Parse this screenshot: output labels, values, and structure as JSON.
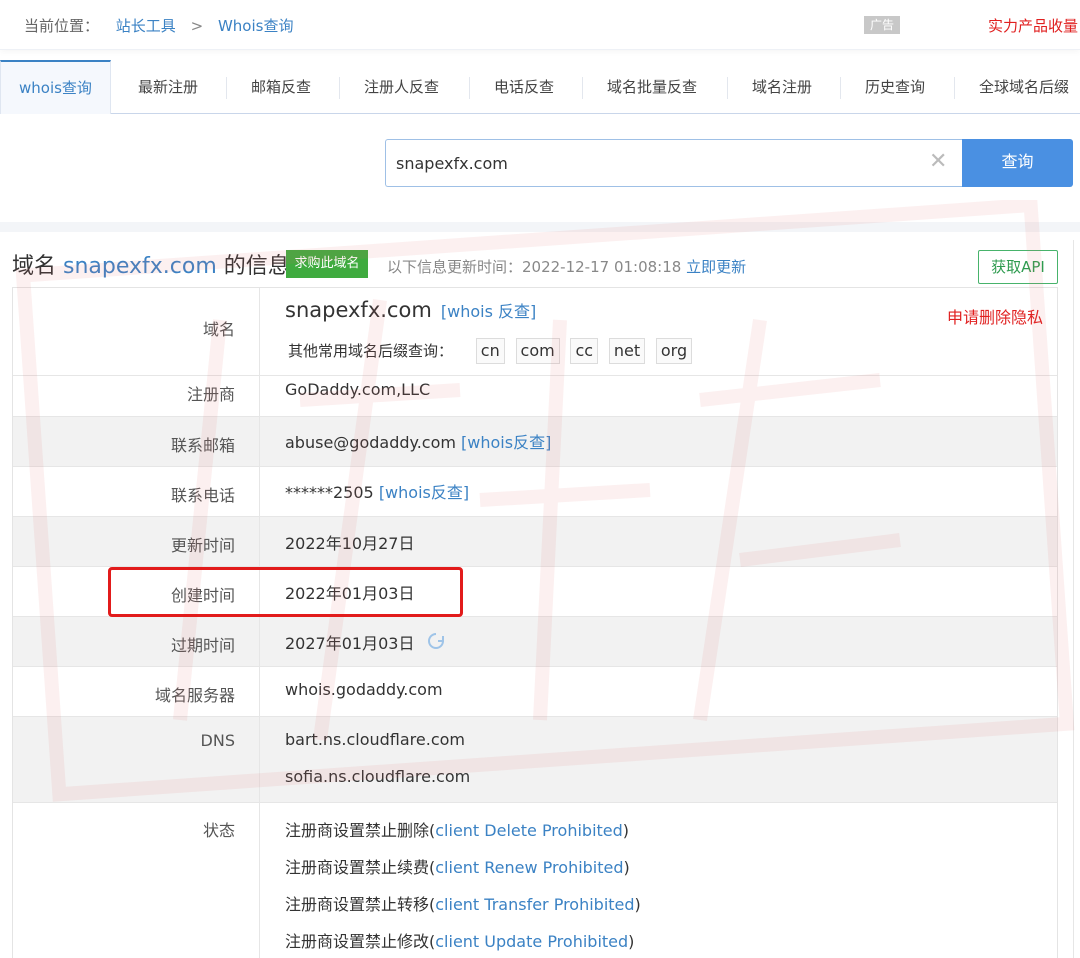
{
  "topbar": {
    "location_label": "当前位置：",
    "crumb_tool": "站长工具",
    "crumb_sep": ">",
    "crumb_whois": "Whois查询",
    "ad_badge": "广告",
    "ad_text": "实力产品收量"
  },
  "tabs": [
    {
      "label": "whois查询",
      "active": true
    },
    {
      "label": "最新注册"
    },
    {
      "label": "邮箱反查"
    },
    {
      "label": "注册人反查"
    },
    {
      "label": "电话反查"
    },
    {
      "label": "域名批量反查"
    },
    {
      "label": "域名注册"
    },
    {
      "label": "历史查询"
    },
    {
      "label": "全球域名后缀"
    }
  ],
  "search": {
    "value": "snapexfx.com",
    "clear_glyph": "✕",
    "button_label": "查询"
  },
  "info": {
    "title_prefix": "域名",
    "title_domain": "snapexfx.com",
    "title_suffix": "的信息",
    "buy_label": "求购此域名",
    "update_label": "以下信息更新时间：2022-12-17 01:08:18",
    "update_link": "立即更新",
    "api_label": "获取API"
  },
  "rows": {
    "domain": {
      "label": "域名",
      "value": "snapexfx.com",
      "whois_link": "[whois 反查]",
      "privacy_link": "申请删除隐私",
      "suffix_label": "其他常用域名后缀查询：",
      "suffixes": [
        "cn",
        "com",
        "cc",
        "net",
        "org"
      ]
    },
    "registrar": {
      "label": "注册商",
      "value": "GoDaddy.com,LLC"
    },
    "email": {
      "label": "联系邮箱",
      "value": "abuse@godaddy.com",
      "link": "[whois反查]"
    },
    "phone": {
      "label": "联系电话",
      "value": "******2505",
      "link": "[whois反查]"
    },
    "updated": {
      "label": "更新时间",
      "value": "2022年10月27日"
    },
    "created": {
      "label": "创建时间",
      "value": "2022年01月03日"
    },
    "expires": {
      "label": "过期时间",
      "value": "2027年01月03日"
    },
    "whois_server": {
      "label": "域名服务器",
      "value": "whois.godaddy.com"
    },
    "dns": {
      "label": "DNS",
      "values": [
        "bart.ns.cloudflare.com",
        "sofia.ns.cloudflare.com"
      ]
    },
    "status": {
      "label": "状态",
      "items": [
        {
          "prefix": "注册商设置禁止删除(",
          "link": "client Delete Prohibited",
          "suffix": ")"
        },
        {
          "prefix": "注册商设置禁止续费(",
          "link": "client Renew Prohibited",
          "suffix": ")"
        },
        {
          "prefix": "注册商设置禁止转移(",
          "link": "client Transfer Prohibited",
          "suffix": ")"
        },
        {
          "prefix": "注册商设置禁止修改(",
          "link": "client Update Prohibited",
          "suffix": ")"
        }
      ]
    }
  },
  "colors": {
    "link": "#3b82c4",
    "accent_button": "#4a90e2",
    "buy_badge": "#3fab3f",
    "alert_red": "#e02020",
    "highlight_box": "#e21b1b"
  }
}
